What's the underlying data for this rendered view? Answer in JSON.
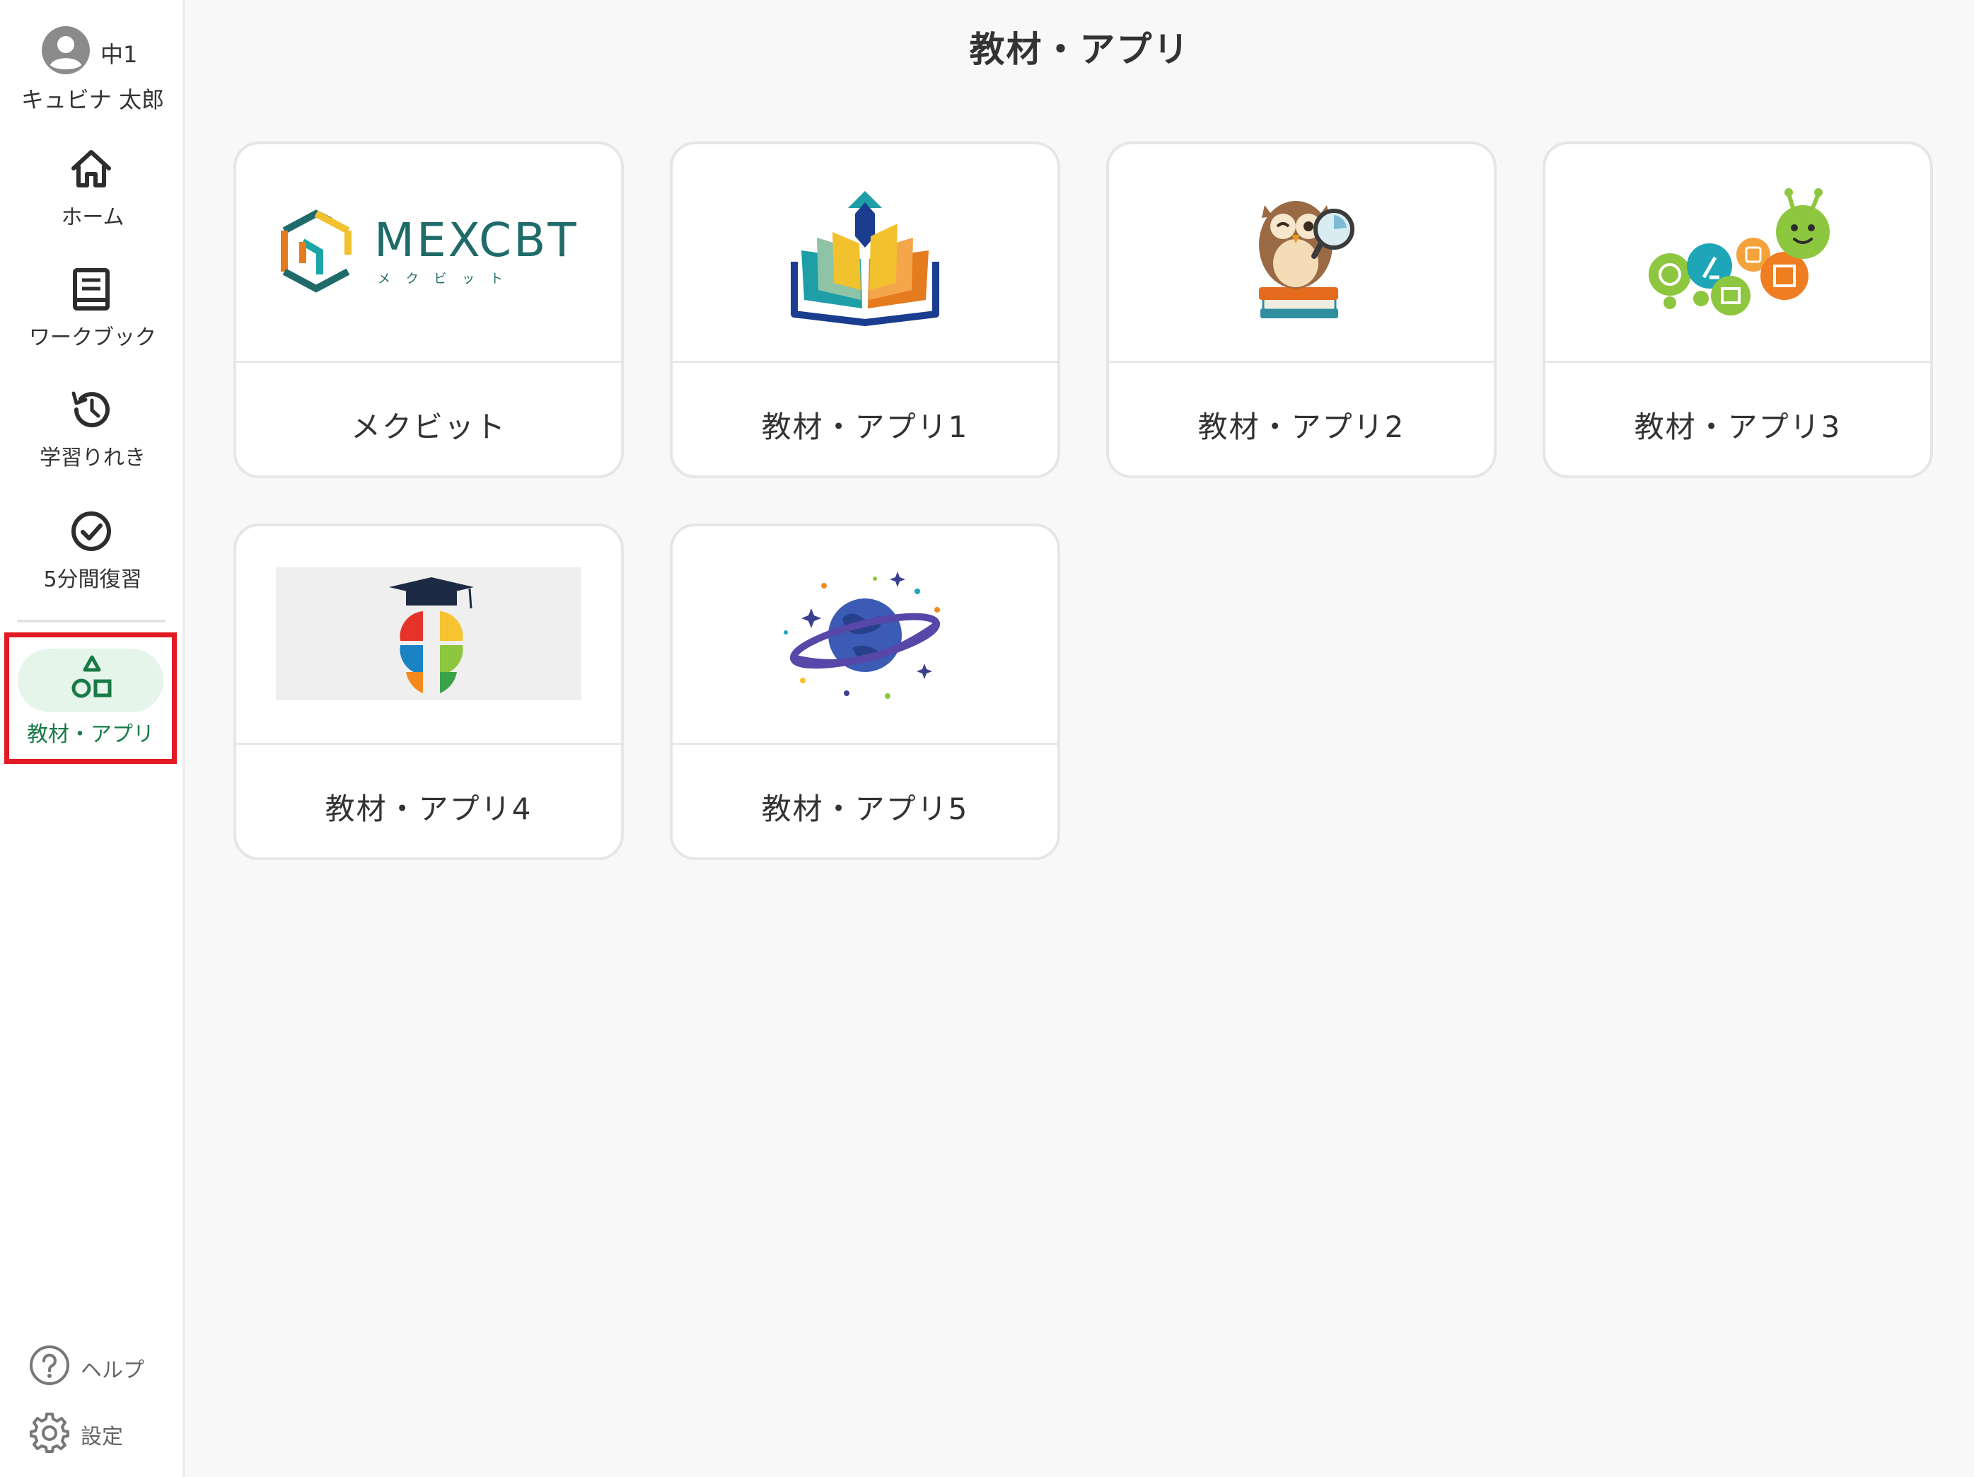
{
  "profile": {
    "grade": "中1",
    "name": "キュビナ 太郎",
    "avatar_icon": "user-avatar-icon"
  },
  "nav": {
    "home": {
      "label": "ホーム",
      "icon": "home-icon"
    },
    "workbook": {
      "label": "ワークブック",
      "icon": "book-icon"
    },
    "history": {
      "label": "学習りれき",
      "icon": "history-icon"
    },
    "review": {
      "label": "5分間復習",
      "icon": "check-circle-icon"
    },
    "materials": {
      "label": "教材・アプリ",
      "icon": "shapes-icon",
      "active": true
    }
  },
  "bottom": {
    "help": {
      "label": "ヘルプ",
      "icon": "help-icon"
    },
    "settings": {
      "label": "設定",
      "icon": "gear-icon"
    }
  },
  "page": {
    "title": "教材・アプリ"
  },
  "cards": [
    {
      "label": "メクビット",
      "logo_text": "MEXCBT",
      "logo_sub": "メ ク ビ ッ ト",
      "icon": "mexcbt-logo"
    },
    {
      "label": "教材・アプリ1",
      "icon": "open-book-icon"
    },
    {
      "label": "教材・アプリ2",
      "icon": "owl-icon"
    },
    {
      "label": "教材・アプリ3",
      "icon": "caterpillar-icon"
    },
    {
      "label": "教材・アプリ4",
      "icon": "puzzle-brain-icon"
    },
    {
      "label": "教材・アプリ5",
      "icon": "planet-icon"
    }
  ],
  "colors": {
    "accent": "#1a7a47",
    "accent_bg": "#e5f5ea",
    "highlight_border": "#e21a24",
    "icon_dark": "#2d2d2d"
  }
}
